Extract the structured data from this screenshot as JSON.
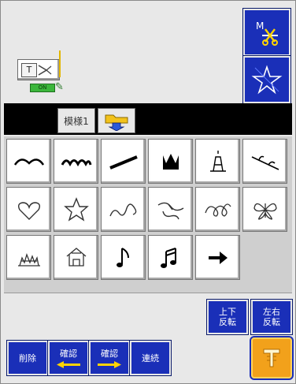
{
  "preview": {
    "thread_label": "T",
    "tag_label": "ON"
  },
  "side_buttons": {
    "top_icon": "scissors-cut-icon",
    "bottom_icon": "star-outline-icon"
  },
  "tabs": [
    {
      "label": "模様1"
    },
    {
      "label": "",
      "icon": "pattern-folder-icon"
    }
  ],
  "patterns": [
    {
      "name": "pattern-scallop-small",
      "icon": "scallop-icon"
    },
    {
      "name": "pattern-triple-scallop",
      "icon": "scallop-triple-icon"
    },
    {
      "name": "pattern-diagonal-bar",
      "icon": "diagonal-bar-icon"
    },
    {
      "name": "pattern-crown",
      "icon": "crown-icon"
    },
    {
      "name": "pattern-tower",
      "icon": "tower-icon"
    },
    {
      "name": "pattern-leaf-branch",
      "icon": "leaf-branch-icon"
    },
    {
      "name": "pattern-heart",
      "icon": "heart-icon"
    },
    {
      "name": "pattern-star",
      "icon": "star-icon"
    },
    {
      "name": "pattern-swirl-wave",
      "icon": "swirl-wave-icon"
    },
    {
      "name": "pattern-floral-vine",
      "icon": "floral-vine-icon"
    },
    {
      "name": "pattern-knot-loop",
      "icon": "knot-loop-icon"
    },
    {
      "name": "pattern-butterfly",
      "icon": "butterfly-icon"
    },
    {
      "name": "pattern-grass",
      "icon": "grass-icon"
    },
    {
      "name": "pattern-house",
      "icon": "house-icon"
    },
    {
      "name": "pattern-music-note",
      "icon": "music-note-icon"
    },
    {
      "name": "pattern-music-double",
      "icon": "music-double-note-icon"
    },
    {
      "name": "pattern-right-arrow",
      "icon": "right-arrow-icon"
    }
  ],
  "bottom": {
    "flip_vertical_line1": "上下",
    "flip_vertical_line2": "反転",
    "flip_horizontal_line1": "左右",
    "flip_horizontal_line2": "反転",
    "delete_label": "削除",
    "confirm_left_label": "確認",
    "confirm_right_label": "確認",
    "continuous_label": "連続",
    "settings_icon": "tool-key-icon"
  },
  "colors": {
    "blue_button": "#1a2fb8",
    "orange_button": "#f2a11b",
    "arrow_yellow": "#ffd400"
  }
}
